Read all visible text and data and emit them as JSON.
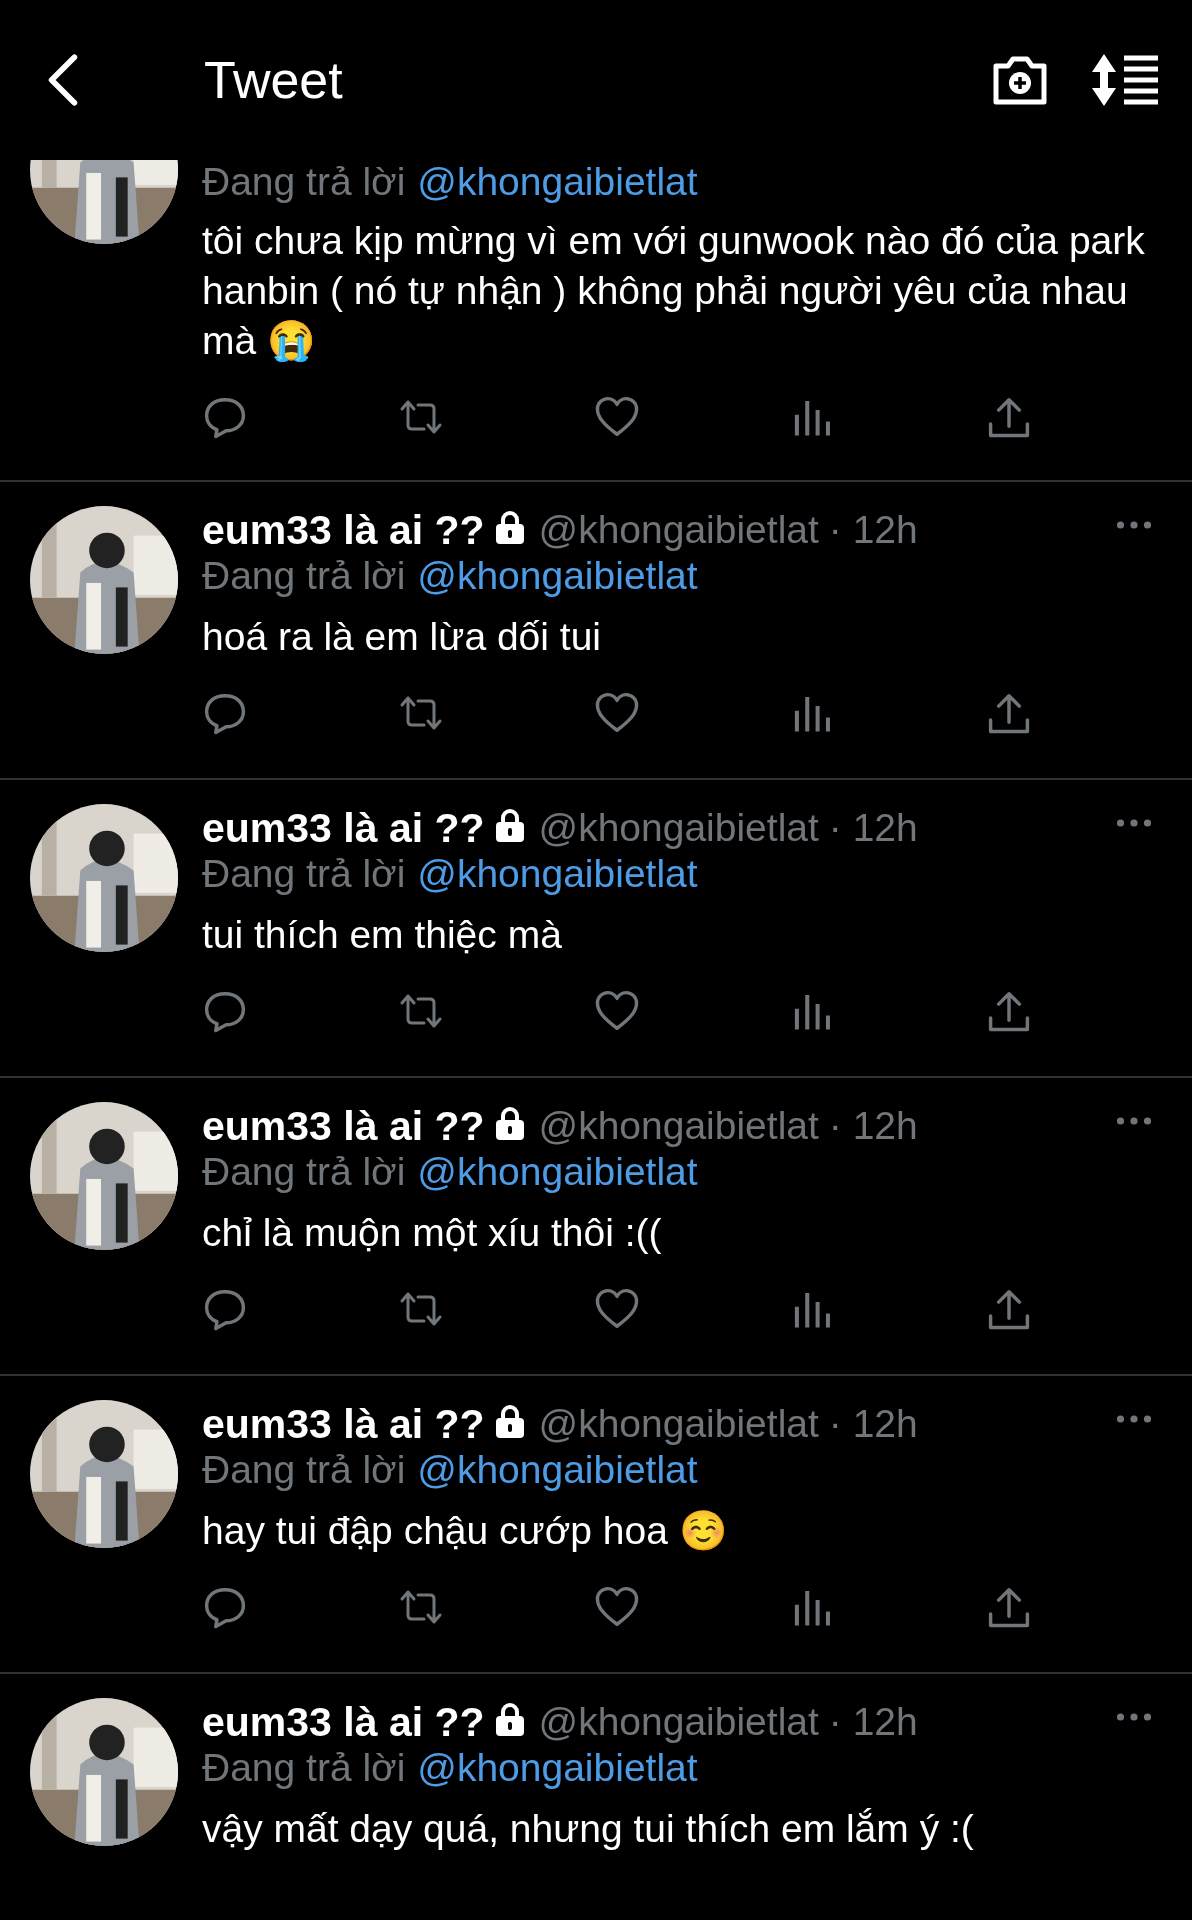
{
  "header": {
    "title": "Tweet"
  },
  "tweets": [
    {
      "reply_label": "Đang trả lời",
      "reply_to": "@khongaibietlat",
      "text": "tôi chưa kịp mừng vì em với gunwook nào đó của park hanbin ( nó tự nhận ) không phải người yêu của nhau mà 😭"
    },
    {
      "name": "eum33 là ai ??",
      "protected": true,
      "handle": "@khongaibietlat",
      "time": "· 12h",
      "reply_label": "Đang trả lời",
      "reply_to": "@khongaibietlat",
      "text": "hoá ra là em lừa dối tui"
    },
    {
      "name": "eum33 là ai ??",
      "protected": true,
      "handle": "@khongaibietlat",
      "time": "· 12h",
      "reply_label": "Đang trả lời",
      "reply_to": "@khongaibietlat",
      "text": "tui thích em thiệc mà"
    },
    {
      "name": "eum33 là ai ??",
      "protected": true,
      "handle": "@khongaibietlat",
      "time": "· 12h",
      "reply_label": "Đang trả lời",
      "reply_to": "@khongaibietlat",
      "text": "chỉ là muộn một xíu thôi :(("
    },
    {
      "name": "eum33 là ai ??",
      "protected": true,
      "handle": "@khongaibietlat",
      "time": "· 12h",
      "reply_label": "Đang trả lời",
      "reply_to": "@khongaibietlat",
      "text": "hay tui đập chậu cướp hoa ☺️"
    },
    {
      "name": "eum33 là ai ??",
      "protected": true,
      "handle": "@khongaibietlat",
      "time": "· 12h",
      "reply_label": "Đang trả lời",
      "reply_to": "@khongaibietlat",
      "text": "vậy mất dạy quá, nhưng tui thích em lắm ý :(",
      "no_actions": true
    }
  ]
}
